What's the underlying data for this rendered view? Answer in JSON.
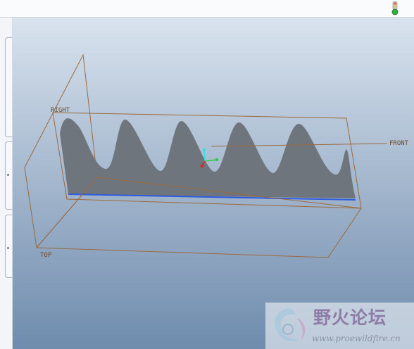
{
  "toolbar": {
    "status_indicator_icon": "traffic-light-icon"
  },
  "viewport": {
    "background_top": "#d9e3ee",
    "background_bottom": "#6f8cad",
    "datum_planes": {
      "right_label": "RIGHT",
      "front_label": "FRONT",
      "top_label": "TOP",
      "plane_color": "#9b6a3d"
    },
    "model": {
      "fill_color": "#6e757d",
      "edge_color": "#2f5bdc"
    },
    "csys": {
      "x_color": "#2ecc40",
      "y_color": "#33e0e0",
      "z_color": "#e02020"
    }
  },
  "watermark": {
    "title": "野火论坛",
    "url": "www.proewildfire.cn"
  }
}
